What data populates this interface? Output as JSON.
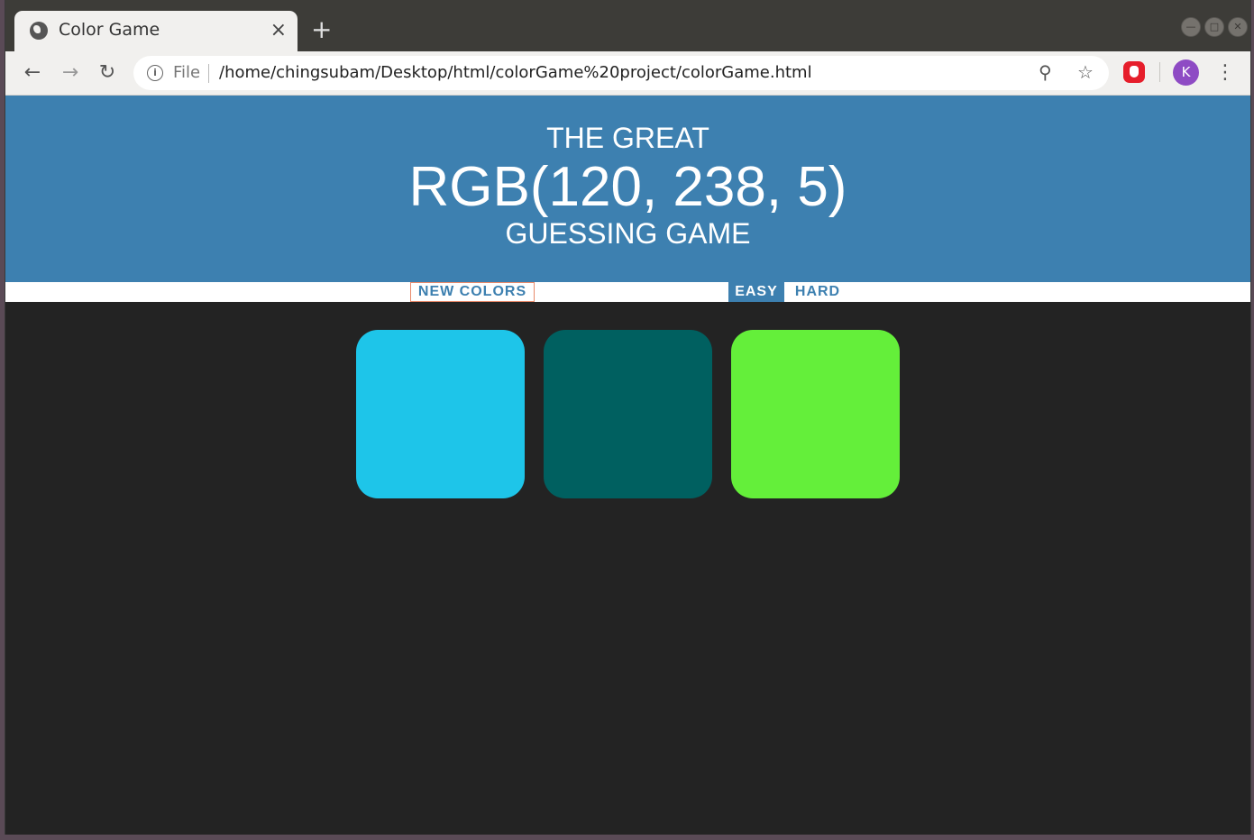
{
  "browser": {
    "tab_title": "Color Game",
    "tab_close": "×",
    "new_tab": "+",
    "file_label": "File",
    "url": "/home/chingsubam/Desktop/html/colorGame%20project/colorGame.html",
    "avatar_letter": "K"
  },
  "game": {
    "header_line1": "THE GREAT",
    "rgb_display": "RGB(120, 238, 5)",
    "header_line3": "GUESSING GAME",
    "new_colors_label": "NEW COLORS",
    "easy_label": "EASY",
    "hard_label": "HARD",
    "selected_mode": "EASY",
    "square_colors": [
      "#1ec5e9",
      "#006060",
      "#64ef3a"
    ]
  },
  "colors": {
    "header_bg": "#3d80b0",
    "body_bg": "#232323"
  }
}
